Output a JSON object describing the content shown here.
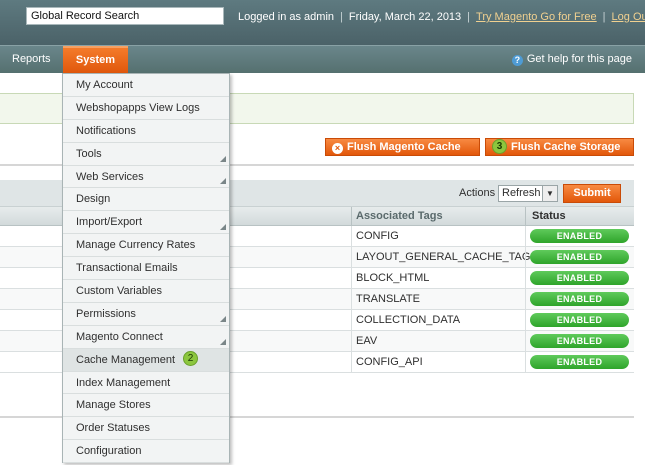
{
  "header": {
    "search_value": "Global Record Search",
    "logged_in": "Logged in as admin",
    "date": "Friday, March 22, 2013",
    "try_link": "Try Magento Go for Free",
    "logout": "Log Out"
  },
  "nav": {
    "reports": "Reports",
    "system": "System",
    "help": "Get help for this page"
  },
  "buttons": {
    "flush_magento": "Flush Magento Cache",
    "flush_storage": "Flush Cache Storage",
    "flush_storage_step": "3"
  },
  "grid": {
    "actions_label": "Actions",
    "actions_value": "Refresh",
    "submit": "Submit",
    "col_tags": "Associated Tags",
    "col_status": "Status",
    "rows": [
      {
        "tag": "CONFIG",
        "status": "ENABLED"
      },
      {
        "tag": "LAYOUT_GENERAL_CACHE_TAG",
        "status": "ENABLED"
      },
      {
        "tag": "BLOCK_HTML",
        "status": "ENABLED"
      },
      {
        "tag": "TRANSLATE",
        "status": "ENABLED"
      },
      {
        "tag": "COLLECTION_DATA",
        "status": "ENABLED"
      },
      {
        "tag": "EAV",
        "status": "ENABLED"
      },
      {
        "tag": "CONFIG_API",
        "status": "ENABLED"
      }
    ]
  },
  "menu": {
    "items": [
      {
        "label": "My Account",
        "submenu": false
      },
      {
        "label": "Webshopapps View Logs",
        "submenu": false
      },
      {
        "label": "Notifications",
        "submenu": false
      },
      {
        "label": "Tools",
        "submenu": true
      },
      {
        "label": "Web Services",
        "submenu": true
      },
      {
        "label": "Design",
        "submenu": false
      },
      {
        "label": "Import/Export",
        "submenu": true
      },
      {
        "label": "Manage Currency Rates",
        "submenu": false
      },
      {
        "label": "Transactional Emails",
        "submenu": false
      },
      {
        "label": "Custom Variables",
        "submenu": false
      },
      {
        "label": "Permissions",
        "submenu": true
      },
      {
        "label": "Magento Connect",
        "submenu": true
      },
      {
        "label": "Cache Management",
        "submenu": false,
        "step": "2"
      },
      {
        "label": "Index Management",
        "submenu": false
      },
      {
        "label": "Manage Stores",
        "submenu": false
      },
      {
        "label": "Order Statuses",
        "submenu": false
      },
      {
        "label": "Configuration",
        "submenu": false
      }
    ]
  },
  "colors": {
    "accent": "#e2570a",
    "header": "#4b6268",
    "enabled": "#2ea42a",
    "step": "#8cc63e"
  }
}
